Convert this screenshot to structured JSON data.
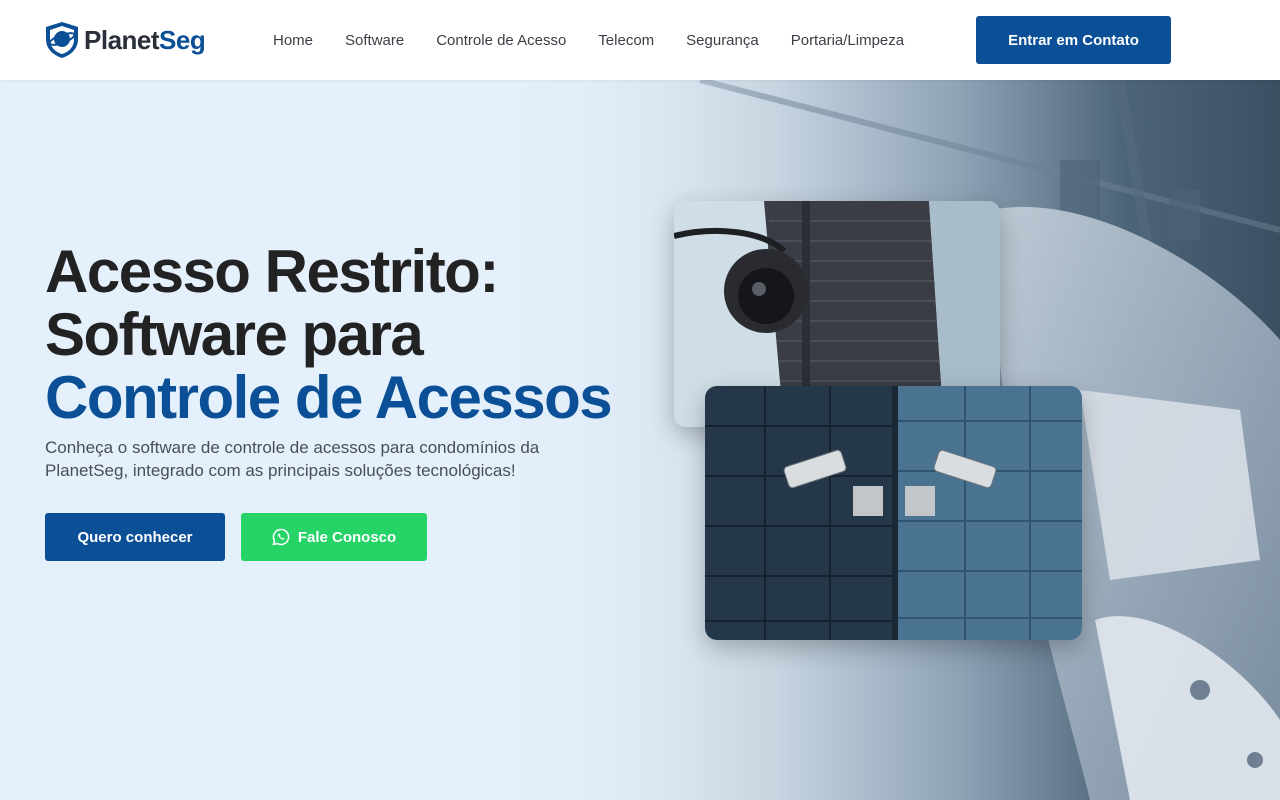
{
  "brand": {
    "name_part1": "Planet",
    "name_part2": "Seg",
    "icon": "shield-planet-logo-icon"
  },
  "nav": {
    "items": [
      {
        "label": "Home"
      },
      {
        "label": "Software"
      },
      {
        "label": "Controle de Acesso"
      },
      {
        "label": "Telecom"
      },
      {
        "label": "Segurança"
      },
      {
        "label": "Portaria/Limpeza"
      }
    ],
    "cta_label": "Entrar em Contato"
  },
  "hero": {
    "title_line1": "Acesso Restrito:",
    "title_line2": "Software para",
    "title_line3": "Controle de Acessos",
    "subtitle": "Conheça o software de controle de acessos para condomínios da PlanetSeg, integrado com as principais soluções tecnológicas!",
    "primary_button": "Quero conhecer",
    "whatsapp_button": "Fale Conosco",
    "whatsapp_icon": "whatsapp-icon"
  },
  "colors": {
    "brand_blue": "#0b4f96",
    "whatsapp_green": "#25d366",
    "text_dark": "#222222"
  }
}
